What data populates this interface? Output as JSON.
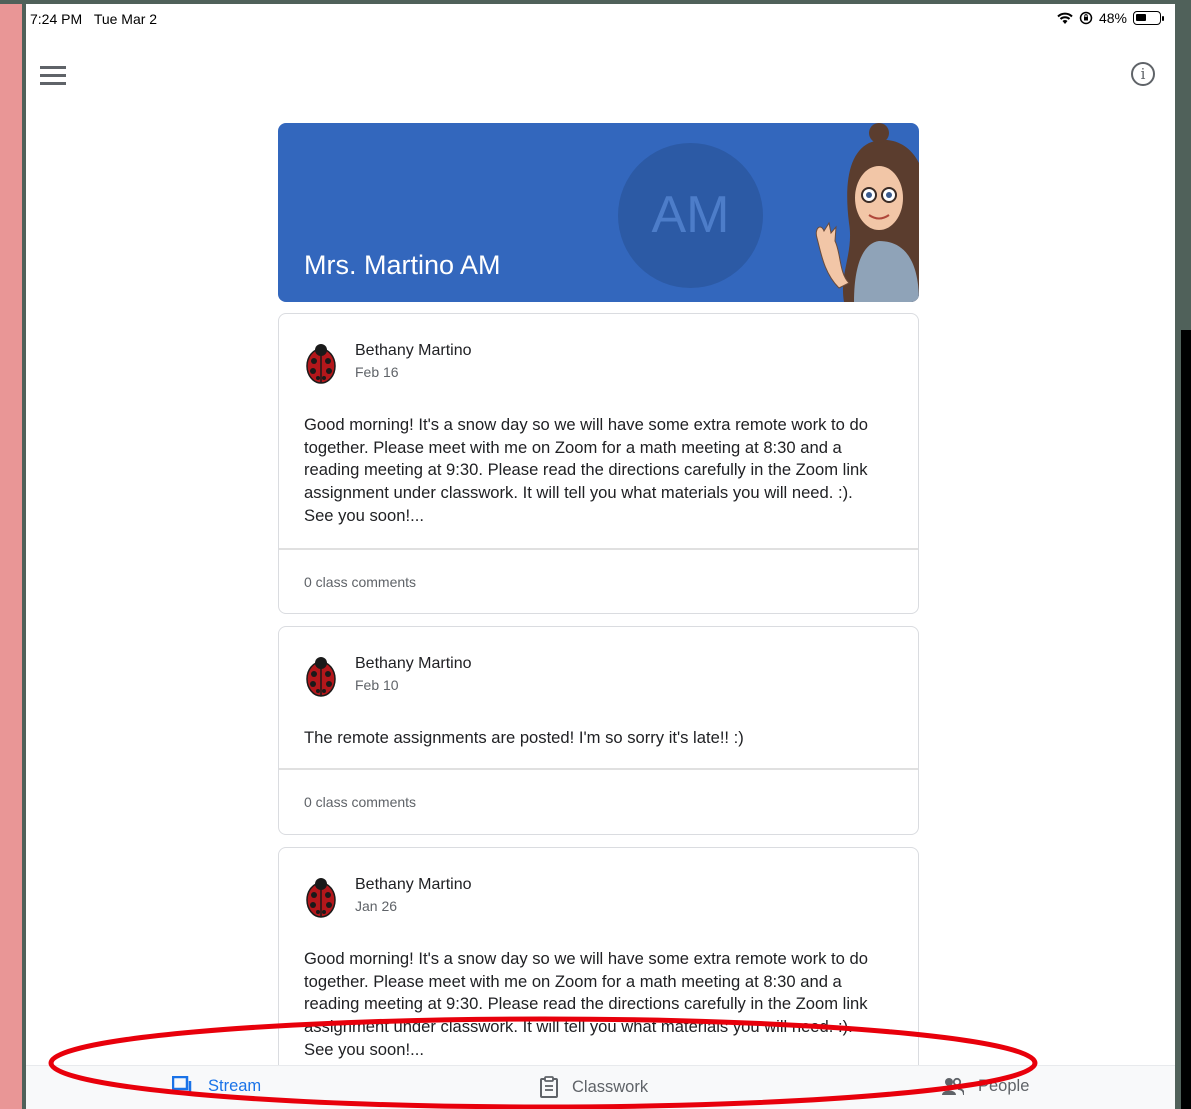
{
  "status": {
    "time": "7:24 PM",
    "date": "Tue Mar 2",
    "battery": "48%",
    "battery_level": 0.48
  },
  "header": {
    "menu_icon": "hamburger-menu-icon",
    "info_icon": "info-icon"
  },
  "banner": {
    "initials": "AM",
    "title": "Mrs. Martino AM",
    "color": "#3367bd"
  },
  "posts": [
    {
      "author": "Bethany Martino",
      "date": "Feb 16",
      "text": "Good morning!  It's a snow day so we will have some extra remote work to do together.  Please meet with me on Zoom for a math meeting at 8:30 and a reading meeting at 9:30.  Please read the directions carefully in the Zoom link assignment under classwork.  It will tell you what materials you will need.  :). See you soon!...",
      "comments": "0 class comments"
    },
    {
      "author": "Bethany Martino",
      "date": "Feb 10",
      "text": "The remote assignments are posted!  I'm so sorry it's late!!  :)",
      "comments": "0 class comments"
    },
    {
      "author": "Bethany Martino",
      "date": "Jan 26",
      "text": "Good morning!  It's a snow day so we will have some extra remote work to do together.  Please meet with me on Zoom for a math meeting at 8:30 and a reading meeting at 9:30.  Please read the directions carefully in the Zoom link assignment under classwork.  It will tell you what materials you will need.  :). See you soon!..."
    }
  ],
  "nav": {
    "stream": "Stream",
    "classwork": "Classwork",
    "people": "People",
    "active_color": "#1a73e8"
  },
  "annotation_color": "#e8000b"
}
